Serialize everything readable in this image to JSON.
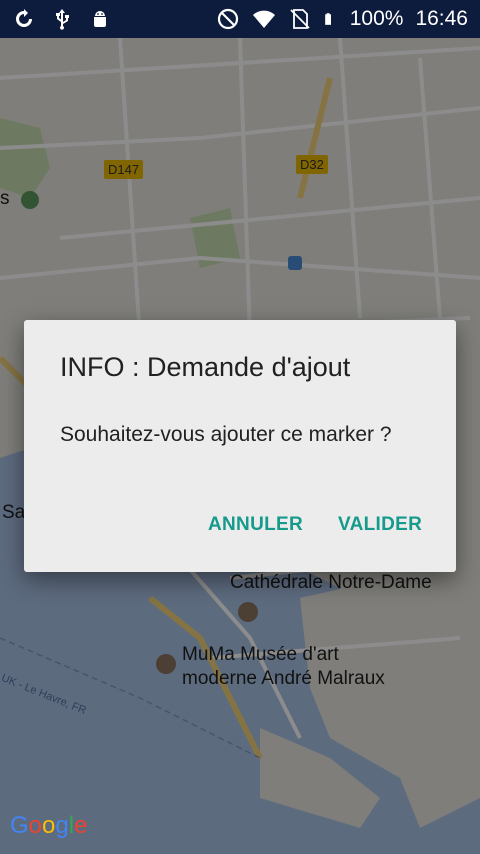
{
  "status_bar": {
    "battery_percent": "100%",
    "time": "16:46",
    "left_icons": [
      "sync-icon",
      "usb-icon",
      "android-icon"
    ],
    "right_icons": [
      "dnd-icon",
      "wifi-icon",
      "no-sim-icon",
      "battery-icon"
    ]
  },
  "map": {
    "road_labels": [
      "D147",
      "D32"
    ],
    "place_labels": {
      "cathedral": "Cathédrale Notre-Dame",
      "museum_line1": "MuMa Musée d'art",
      "museum_line2": "moderne André Malraux",
      "ferry": "UK - Le Havre, FR",
      "left_s": "s",
      "left_sa": "Sa"
    },
    "attribution": "Google",
    "colors": {
      "land": "#e8e5df",
      "water": "#a9c3e8",
      "park": "#c6dfb1",
      "road_major": "#f3d27a"
    }
  },
  "dialog": {
    "title": "INFO : Demande d'ajout",
    "message": "Souhaitez-vous ajouter ce marker ?",
    "cancel_label": "ANNULER",
    "confirm_label": "VALIDER",
    "accent_color": "#159a8c"
  }
}
